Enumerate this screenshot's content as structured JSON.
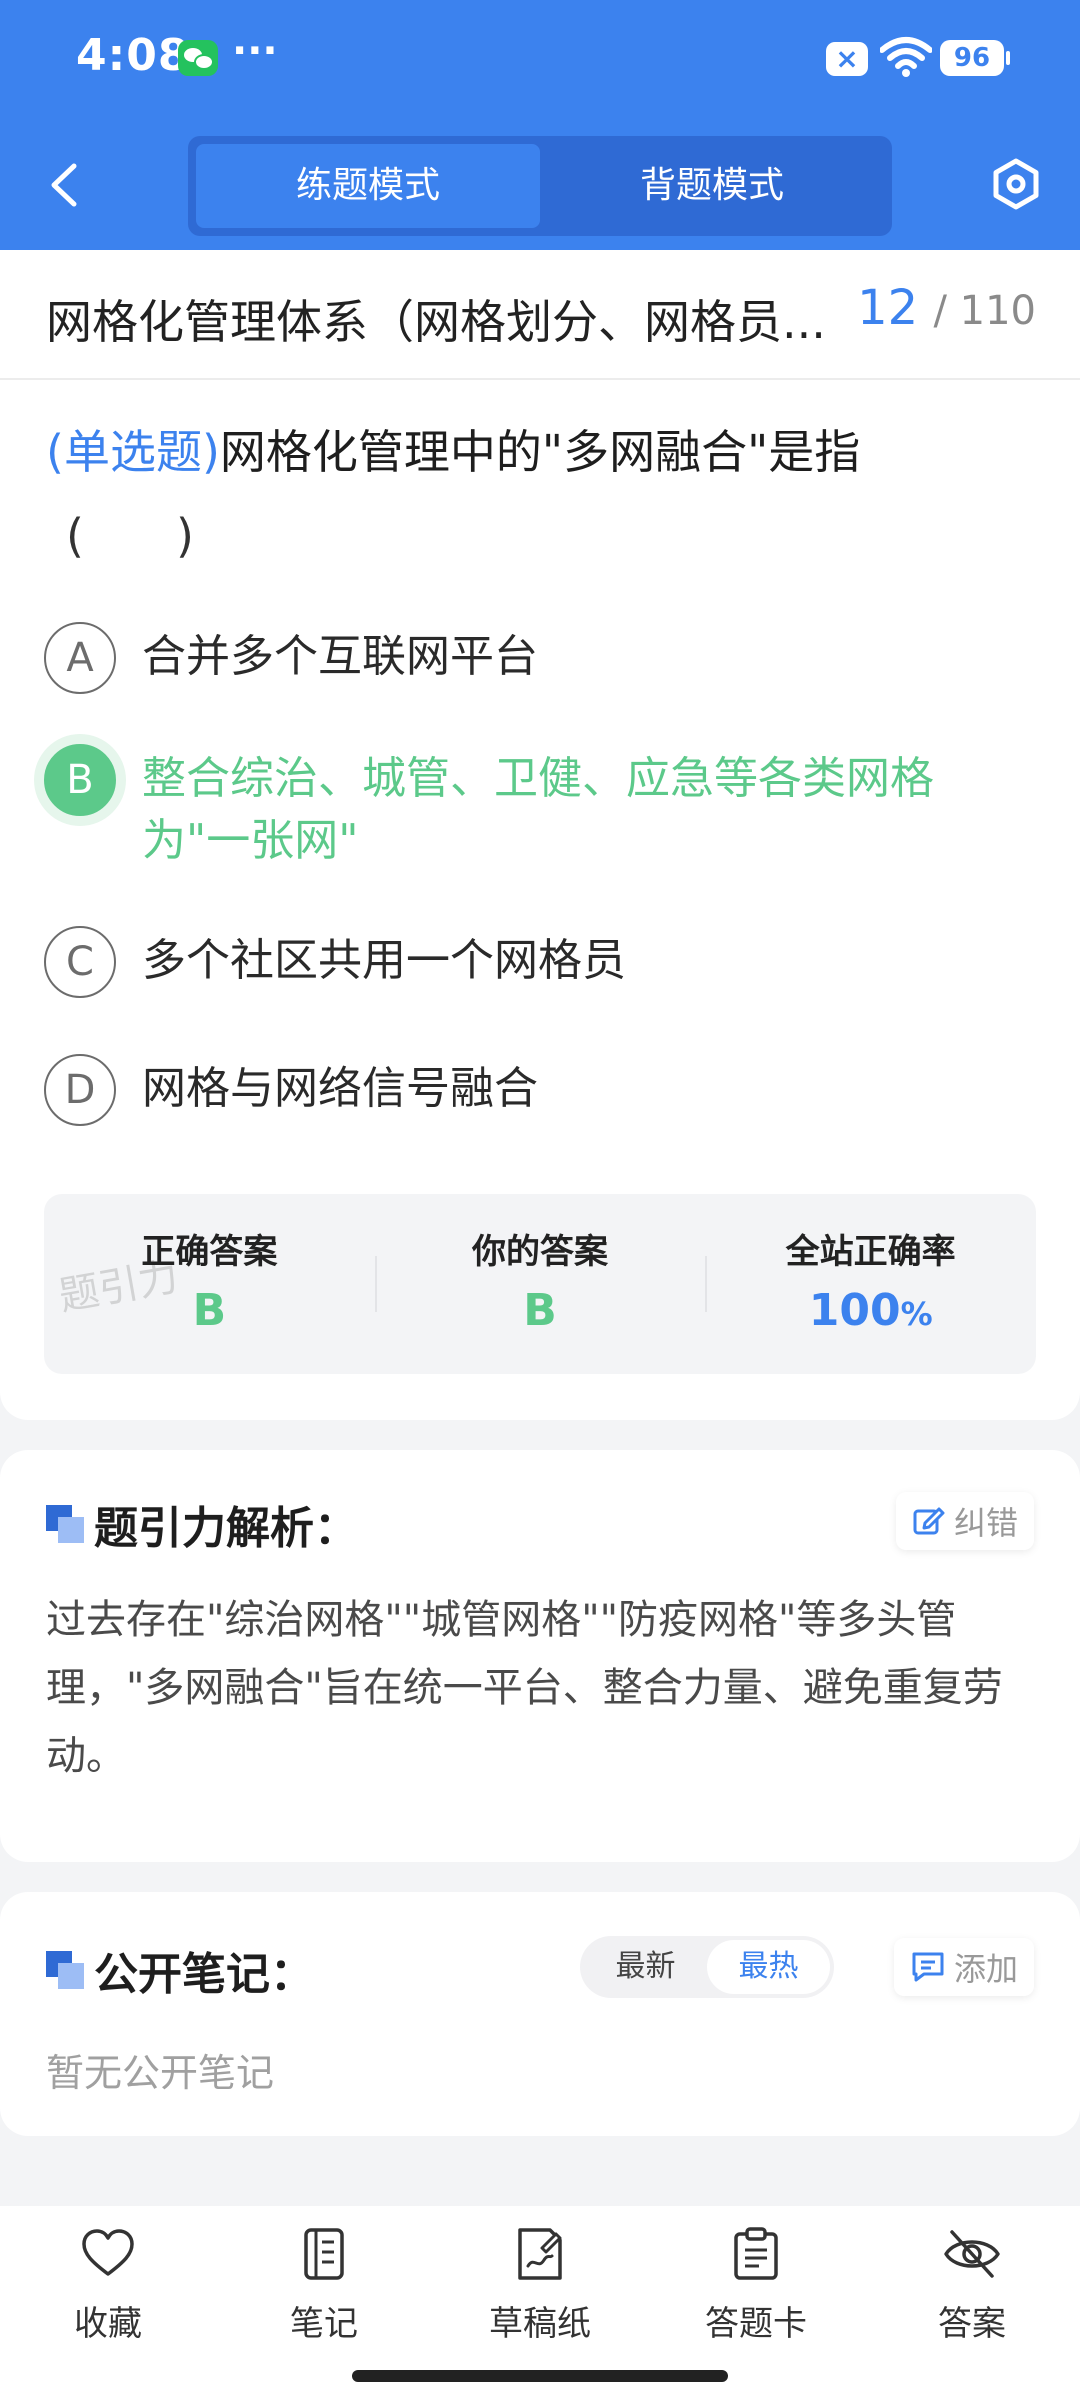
{
  "status_bar": {
    "time": "4:08",
    "more": "···",
    "battery": "96"
  },
  "header": {
    "modes": [
      "练题模式",
      "背题模式"
    ],
    "active_mode": 0
  },
  "chapter": {
    "title": "网格化管理体系（网格划分、网格员...",
    "current": "12",
    "total": "/ 110"
  },
  "question": {
    "type": "(单选题)",
    "text": "网格化管理中的\"多网融合\"是指",
    "blank": "(　　)",
    "options": [
      {
        "letter": "A",
        "text": "合并多个互联网平台"
      },
      {
        "letter": "B",
        "text": "整合综治、城管、卫健、应急等各类网格为\"一张网\""
      },
      {
        "letter": "C",
        "text": "多个社区共用一个网格员"
      },
      {
        "letter": "D",
        "text": "网格与网络信号融合"
      }
    ]
  },
  "answers": {
    "correct_label": "正确答案",
    "correct_value": "B",
    "yours_label": "你的答案",
    "yours_value": "B",
    "rate_label": "全站正确率",
    "rate_value": "100",
    "rate_unit": "%",
    "watermark": "题引力"
  },
  "analysis": {
    "title": "题引力解析：",
    "report_label": "纠错",
    "text": "过去存在\"综治网格\"\"城管网格\"\"防疫网格\"等多头管理，\"多网融合\"旨在统一平台、整合力量、避免重复劳动。"
  },
  "notes": {
    "title": "公开笔记：",
    "sort_options": [
      "最新",
      "最热"
    ],
    "active_sort": 1,
    "add_label": "添加",
    "empty_text": "暂无公开笔记"
  },
  "bottom_bar": {
    "items": [
      {
        "label": "收藏",
        "icon": "heart-icon"
      },
      {
        "label": "笔记",
        "icon": "notebook-icon"
      },
      {
        "label": "草稿纸",
        "icon": "draft-icon"
      },
      {
        "label": "答题卡",
        "icon": "clipboard-icon"
      },
      {
        "label": "答案",
        "icon": "eye-off-icon"
      }
    ]
  },
  "colors": {
    "primary": "#3c82ee",
    "correct": "#5cc98a",
    "text": "#1e1e1e"
  }
}
